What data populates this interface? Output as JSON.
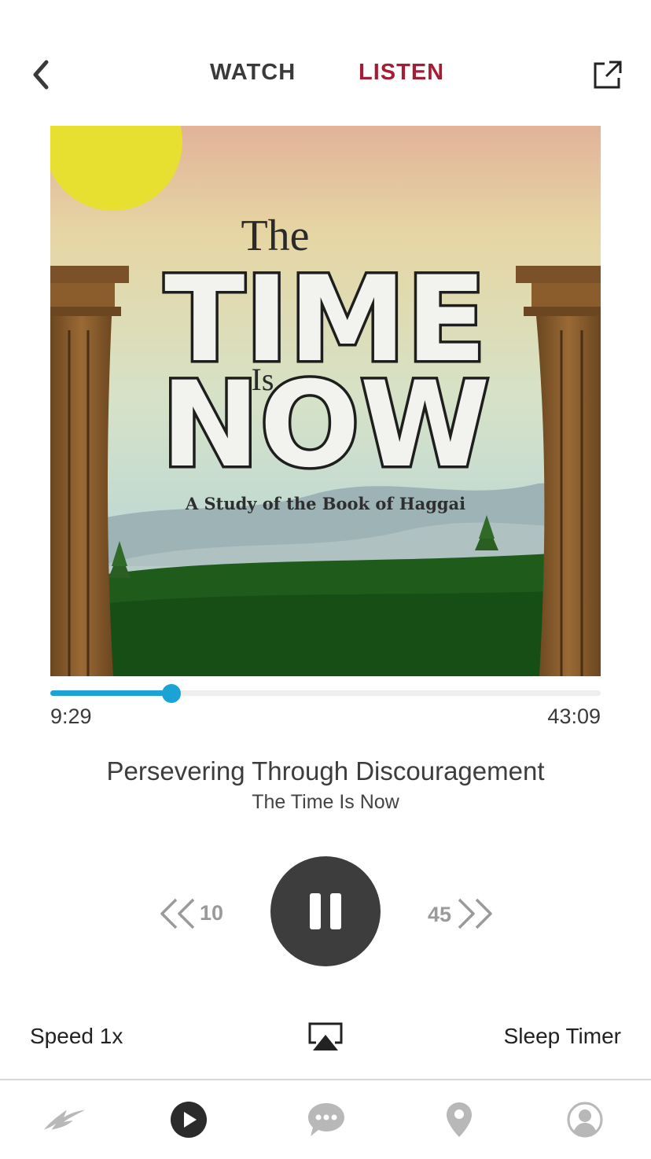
{
  "header": {
    "tabs": [
      {
        "label": "WATCH",
        "active": false
      },
      {
        "label": "LISTEN",
        "active": true
      }
    ],
    "back_icon": "chevron-left-icon",
    "share_icon": "external-link-icon"
  },
  "artwork": {
    "title_the": "The",
    "title_time": "TIME",
    "title_is": "Is",
    "title_now": "NOW",
    "tagline": "A Study of the Book of Haggai"
  },
  "player": {
    "elapsed": "9:29",
    "total": "43:09",
    "progress_fraction": 0.22,
    "episode_title": "Persevering Through Discouragement",
    "series_title": "The Time Is Now",
    "rewind_seconds": "10",
    "forward_seconds": "45",
    "state": "playing"
  },
  "options": {
    "speed_label": "Speed 1x",
    "airplay_icon": "airplay-icon",
    "sleep_label": "Sleep Timer"
  },
  "nav": [
    {
      "icon": "logo-icon",
      "active": false
    },
    {
      "icon": "play-circle-icon",
      "active": true
    },
    {
      "icon": "chat-bubble-icon",
      "active": false
    },
    {
      "icon": "location-pin-icon",
      "active": false
    },
    {
      "icon": "profile-icon",
      "active": false
    }
  ],
  "colors": {
    "accent": "#a51d35",
    "progress": "#1aa3d4",
    "dark": "#3d3d3d",
    "inactive": "#b8b8b8"
  }
}
